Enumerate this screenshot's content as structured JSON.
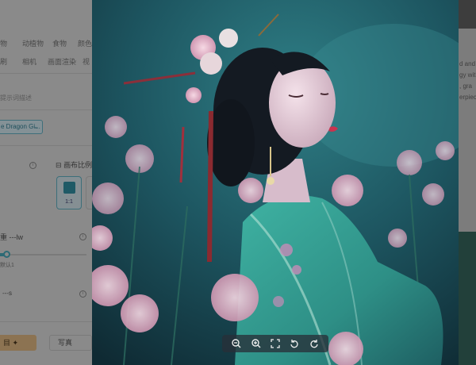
{
  "left_panel": {
    "category_tags_row1": [
      "物",
      "动植物",
      "食物",
      "颜色"
    ],
    "category_tags_row2": [
      "刷",
      "相机",
      "画面渲染",
      "视"
    ],
    "prompt_hint": "提示词描述",
    "selected_model": "e Dragon Gi...",
    "aspect_ratio_label": "画布比例",
    "aspect_ratio_value": "1:1",
    "weight_label": "重 ---lw",
    "weight_default": "默认1",
    "seed_label": "---s",
    "generate_label": "目 ✦",
    "realistic_label": "写真"
  },
  "right_panel": {
    "lines": [
      "d and",
      "gy with",
      ", gra",
      "erpiece"
    ]
  },
  "viewer": {
    "toolbar": [
      "zoom-out-icon",
      "zoom-in-icon",
      "fullscreen-icon",
      "rotate-left-icon",
      "rotate-right-icon"
    ]
  },
  "colors": {
    "accent_teal": "#2d6a75",
    "accent_gold": "#8c7352",
    "overlay": "rgba(0,0,0,0.45)"
  }
}
